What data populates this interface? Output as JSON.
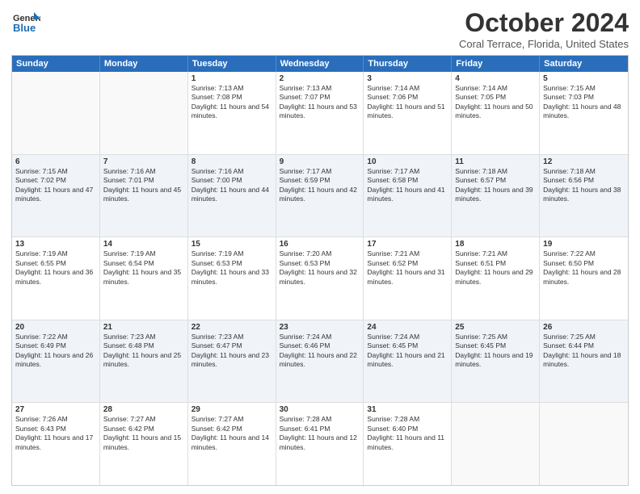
{
  "header": {
    "logo_general": "General",
    "logo_blue": "Blue",
    "month_title": "October 2024",
    "location": "Coral Terrace, Florida, United States"
  },
  "days_of_week": [
    "Sunday",
    "Monday",
    "Tuesday",
    "Wednesday",
    "Thursday",
    "Friday",
    "Saturday"
  ],
  "weeks": [
    [
      {
        "day": "",
        "empty": true
      },
      {
        "day": "",
        "empty": true
      },
      {
        "day": "1",
        "sunrise": "Sunrise: 7:13 AM",
        "sunset": "Sunset: 7:08 PM",
        "daylight": "Daylight: 11 hours and 54 minutes."
      },
      {
        "day": "2",
        "sunrise": "Sunrise: 7:13 AM",
        "sunset": "Sunset: 7:07 PM",
        "daylight": "Daylight: 11 hours and 53 minutes."
      },
      {
        "day": "3",
        "sunrise": "Sunrise: 7:14 AM",
        "sunset": "Sunset: 7:06 PM",
        "daylight": "Daylight: 11 hours and 51 minutes."
      },
      {
        "day": "4",
        "sunrise": "Sunrise: 7:14 AM",
        "sunset": "Sunset: 7:05 PM",
        "daylight": "Daylight: 11 hours and 50 minutes."
      },
      {
        "day": "5",
        "sunrise": "Sunrise: 7:15 AM",
        "sunset": "Sunset: 7:03 PM",
        "daylight": "Daylight: 11 hours and 48 minutes."
      }
    ],
    [
      {
        "day": "6",
        "sunrise": "Sunrise: 7:15 AM",
        "sunset": "Sunset: 7:02 PM",
        "daylight": "Daylight: 11 hours and 47 minutes."
      },
      {
        "day": "7",
        "sunrise": "Sunrise: 7:16 AM",
        "sunset": "Sunset: 7:01 PM",
        "daylight": "Daylight: 11 hours and 45 minutes."
      },
      {
        "day": "8",
        "sunrise": "Sunrise: 7:16 AM",
        "sunset": "Sunset: 7:00 PM",
        "daylight": "Daylight: 11 hours and 44 minutes."
      },
      {
        "day": "9",
        "sunrise": "Sunrise: 7:17 AM",
        "sunset": "Sunset: 6:59 PM",
        "daylight": "Daylight: 11 hours and 42 minutes."
      },
      {
        "day": "10",
        "sunrise": "Sunrise: 7:17 AM",
        "sunset": "Sunset: 6:58 PM",
        "daylight": "Daylight: 11 hours and 41 minutes."
      },
      {
        "day": "11",
        "sunrise": "Sunrise: 7:18 AM",
        "sunset": "Sunset: 6:57 PM",
        "daylight": "Daylight: 11 hours and 39 minutes."
      },
      {
        "day": "12",
        "sunrise": "Sunrise: 7:18 AM",
        "sunset": "Sunset: 6:56 PM",
        "daylight": "Daylight: 11 hours and 38 minutes."
      }
    ],
    [
      {
        "day": "13",
        "sunrise": "Sunrise: 7:19 AM",
        "sunset": "Sunset: 6:55 PM",
        "daylight": "Daylight: 11 hours and 36 minutes."
      },
      {
        "day": "14",
        "sunrise": "Sunrise: 7:19 AM",
        "sunset": "Sunset: 6:54 PM",
        "daylight": "Daylight: 11 hours and 35 minutes."
      },
      {
        "day": "15",
        "sunrise": "Sunrise: 7:19 AM",
        "sunset": "Sunset: 6:53 PM",
        "daylight": "Daylight: 11 hours and 33 minutes."
      },
      {
        "day": "16",
        "sunrise": "Sunrise: 7:20 AM",
        "sunset": "Sunset: 6:53 PM",
        "daylight": "Daylight: 11 hours and 32 minutes."
      },
      {
        "day": "17",
        "sunrise": "Sunrise: 7:21 AM",
        "sunset": "Sunset: 6:52 PM",
        "daylight": "Daylight: 11 hours and 31 minutes."
      },
      {
        "day": "18",
        "sunrise": "Sunrise: 7:21 AM",
        "sunset": "Sunset: 6:51 PM",
        "daylight": "Daylight: 11 hours and 29 minutes."
      },
      {
        "day": "19",
        "sunrise": "Sunrise: 7:22 AM",
        "sunset": "Sunset: 6:50 PM",
        "daylight": "Daylight: 11 hours and 28 minutes."
      }
    ],
    [
      {
        "day": "20",
        "sunrise": "Sunrise: 7:22 AM",
        "sunset": "Sunset: 6:49 PM",
        "daylight": "Daylight: 11 hours and 26 minutes."
      },
      {
        "day": "21",
        "sunrise": "Sunrise: 7:23 AM",
        "sunset": "Sunset: 6:48 PM",
        "daylight": "Daylight: 11 hours and 25 minutes."
      },
      {
        "day": "22",
        "sunrise": "Sunrise: 7:23 AM",
        "sunset": "Sunset: 6:47 PM",
        "daylight": "Daylight: 11 hours and 23 minutes."
      },
      {
        "day": "23",
        "sunrise": "Sunrise: 7:24 AM",
        "sunset": "Sunset: 6:46 PM",
        "daylight": "Daylight: 11 hours and 22 minutes."
      },
      {
        "day": "24",
        "sunrise": "Sunrise: 7:24 AM",
        "sunset": "Sunset: 6:45 PM",
        "daylight": "Daylight: 11 hours and 21 minutes."
      },
      {
        "day": "25",
        "sunrise": "Sunrise: 7:25 AM",
        "sunset": "Sunset: 6:45 PM",
        "daylight": "Daylight: 11 hours and 19 minutes."
      },
      {
        "day": "26",
        "sunrise": "Sunrise: 7:25 AM",
        "sunset": "Sunset: 6:44 PM",
        "daylight": "Daylight: 11 hours and 18 minutes."
      }
    ],
    [
      {
        "day": "27",
        "sunrise": "Sunrise: 7:26 AM",
        "sunset": "Sunset: 6:43 PM",
        "daylight": "Daylight: 11 hours and 17 minutes."
      },
      {
        "day": "28",
        "sunrise": "Sunrise: 7:27 AM",
        "sunset": "Sunset: 6:42 PM",
        "daylight": "Daylight: 11 hours and 15 minutes."
      },
      {
        "day": "29",
        "sunrise": "Sunrise: 7:27 AM",
        "sunset": "Sunset: 6:42 PM",
        "daylight": "Daylight: 11 hours and 14 minutes."
      },
      {
        "day": "30",
        "sunrise": "Sunrise: 7:28 AM",
        "sunset": "Sunset: 6:41 PM",
        "daylight": "Daylight: 11 hours and 12 minutes."
      },
      {
        "day": "31",
        "sunrise": "Sunrise: 7:28 AM",
        "sunset": "Sunset: 6:40 PM",
        "daylight": "Daylight: 11 hours and 11 minutes."
      },
      {
        "day": "",
        "empty": true
      },
      {
        "day": "",
        "empty": true
      }
    ]
  ]
}
